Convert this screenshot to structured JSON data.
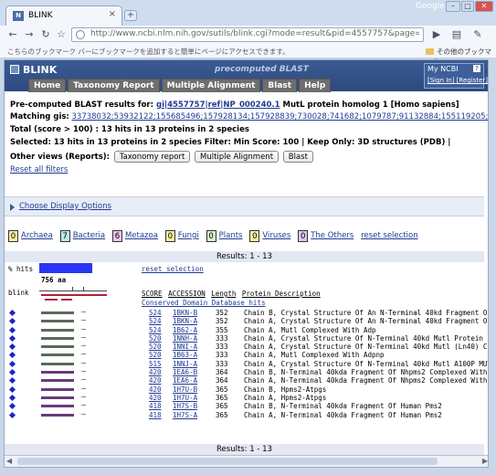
{
  "browser": {
    "tab_title": "BLINK",
    "tab_favicon": "N",
    "tab_close": "×",
    "new_tab": "+",
    "brand": "Google",
    "url": "http://www.ncbi.nlm.nih.gov/sutils/blink.cgi?mode=result&pid=4557757&page=0&taxon_mode=al",
    "bookmark_message": "こちらのブックマーク バーにブックマークを追加すると簡単にページにアクセスできます。",
    "other_bookmarks": "その他のブックマーク"
  },
  "header": {
    "app": "BLINK",
    "subtitle": "precomputed BLAST",
    "nav": [
      "Home",
      "Taxonomy Report",
      "Multiple Alignment",
      "Blast",
      "Help"
    ],
    "myncbi_title": "My NCBI",
    "myncbi_help": "?",
    "signin": "[Sign In]",
    "register": "[Register]"
  },
  "summary": {
    "precomputed_label": "Pre-computed BLAST results for:",
    "gi_link": "gi|4557757|ref|NP_000240.1",
    "protein": "MutL protein homolog 1 [Homo sapiens]",
    "matching_label": "Matching gis:",
    "matching_gis": "33738032;53932122;155685496;157928134;157928839;730028;741682;1079787;91132884;155119205;463989;119584889;2780",
    "total": "Total (score > 100) : 13 hits in 13 proteins in 2 species",
    "selected": "Selected: 13 hits in 13 proteins in 2 species   Filter: Min Score: 100 | Keep Only: 3D structures (PDB) |",
    "other_views": "Other views (Reports):",
    "btn_tax": "Taxonomy report",
    "btn_ma": "Multiple Alignment",
    "btn_blast": "Blast",
    "reset_filters": "Reset all filters",
    "display_options": "Choose Display Options"
  },
  "taxonomy": [
    {
      "count": "0",
      "name": "Archaea",
      "color": "#f5f0a0"
    },
    {
      "count": "7",
      "name": "Bacteria",
      "color": "#bfe8e8"
    },
    {
      "count": "6",
      "name": "Metazoa",
      "color": "#f4c3ee"
    },
    {
      "count": "0",
      "name": "Fungi",
      "color": "#f5f0a0"
    },
    {
      "count": "0",
      "name": "Plants",
      "color": "#d5f2c4"
    },
    {
      "count": "0",
      "name": "Viruses",
      "color": "#f5f0a0"
    },
    {
      "count": "0",
      "name": "The Others",
      "color": "#d8c8f3"
    }
  ],
  "reset_selection": "reset selection",
  "results_label": "Results: 1 - 13",
  "alignment": {
    "pct_hits": "% hits",
    "length": "756 aa",
    "blink_label": "blink",
    "cols": [
      "SCORE",
      "ACCESSION",
      "Length",
      "Protein Description"
    ],
    "cdd_link": "Conserved Domain Database hits"
  },
  "hits": [
    {
      "score": "524",
      "acc": "1BKN-B",
      "len": "352",
      "desc": "Chain B, Crystal Structure Of An N-Terminal 40kd Fragment Of",
      "bar": "#5a6a5a"
    },
    {
      "score": "524",
      "acc": "1BKN-A",
      "len": "352",
      "desc": "Chain A, Crystal Structure Of An N-Terminal 40kd Fragment Of",
      "bar": "#5a6a5a"
    },
    {
      "score": "524",
      "acc": "1B62-A",
      "len": "355",
      "desc": "Chain A, Mutl Complexed With Adp",
      "bar": "#5a6a5a"
    },
    {
      "score": "520",
      "acc": "1NNH-A",
      "len": "333",
      "desc": "Chain A, Crystal Structure Of N-Terminal 40kd Mutl Protein",
      "bar": "#5a6a5a"
    },
    {
      "score": "520",
      "acc": "1NNI-A",
      "len": "333",
      "desc": "Chain A, Crystal Structure Of N-Terminal 40kd Mutl (Ln40) C",
      "bar": "#5a6a5a"
    },
    {
      "score": "520",
      "acc": "1B63-A",
      "len": "333",
      "desc": "Chain A, Mutl Complexed With Adpnp",
      "bar": "#5a6a5a"
    },
    {
      "score": "515",
      "acc": "1NNJ-A",
      "len": "333",
      "desc": "Chain A, Crystal Structure Of N-Terminal 40kd Mutl A100P MUT",
      "bar": "#5a6a5a"
    },
    {
      "score": "420",
      "acc": "1EA6-B",
      "len": "364",
      "desc": "Chain B, N-Terminal 40kda Fragment Of Nhpms2 Complexed With",
      "bar": "#6a3a7a"
    },
    {
      "score": "420",
      "acc": "1EA6-A",
      "len": "364",
      "desc": "Chain A, N-Terminal 40kda Fragment Of Nhpms2 Complexed With",
      "bar": "#6a3a7a"
    },
    {
      "score": "420",
      "acc": "1H7U-B",
      "len": "365",
      "desc": "Chain B, Hpms2-Atpgs",
      "bar": "#6a3a7a"
    },
    {
      "score": "420",
      "acc": "1H7U-A",
      "len": "365",
      "desc": "Chain A, Hpms2-Atpgs",
      "bar": "#6a3a7a"
    },
    {
      "score": "418",
      "acc": "1H7S-B",
      "len": "365",
      "desc": "Chain B, N-Terminal 40kda Fragment Of Human Pms2",
      "bar": "#6a3a7a"
    },
    {
      "score": "418",
      "acc": "1H7S-A",
      "len": "365",
      "desc": "Chain A, N-Terminal 40kda Fragment Of Human Pms2",
      "bar": "#6a3a7a"
    }
  ]
}
